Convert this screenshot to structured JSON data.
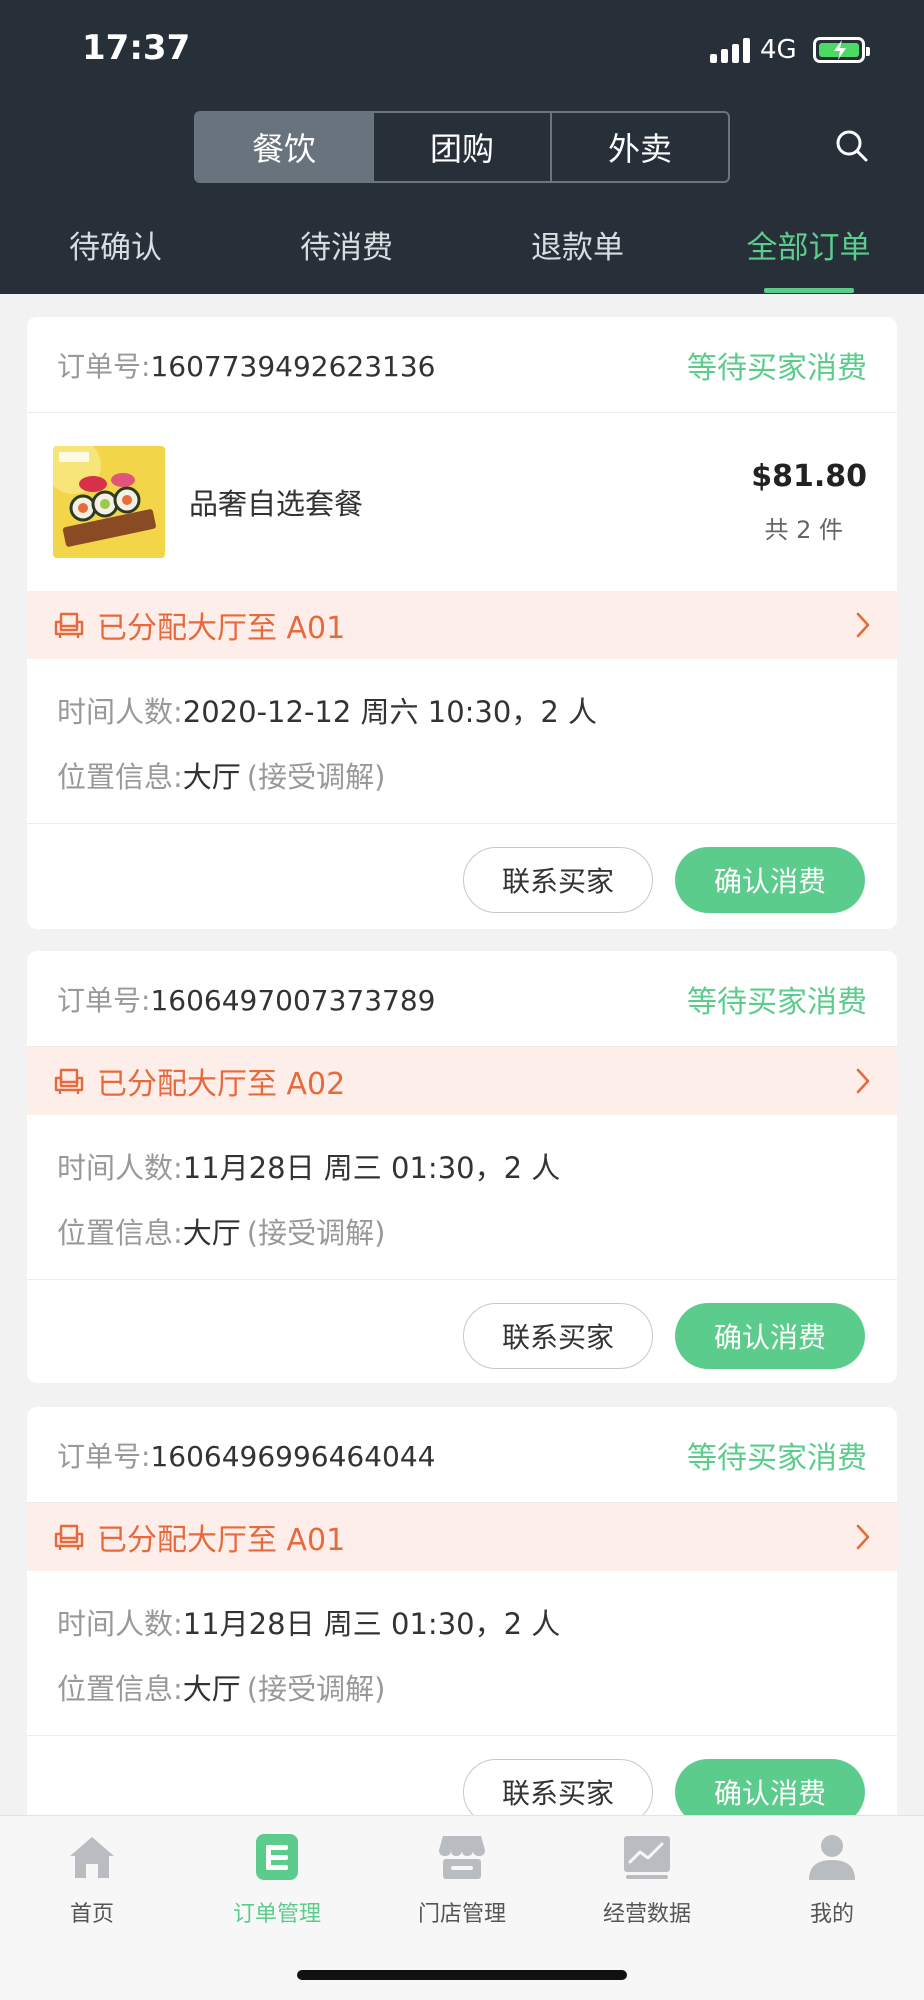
{
  "status_bar": {
    "time": "17:37",
    "network": "4G"
  },
  "segments": [
    {
      "label": "餐饮",
      "active": true
    },
    {
      "label": "团购",
      "active": false
    },
    {
      "label": "外卖",
      "active": false
    }
  ],
  "tabs": [
    {
      "label": "待确认"
    },
    {
      "label": "待消费"
    },
    {
      "label": "退款单"
    },
    {
      "label": "全部订单",
      "active": true
    }
  ],
  "orders": [
    {
      "order_label": "订单号:",
      "order_no": "1607739492623136",
      "status": "等待买家消费",
      "product": {
        "name": "品奢自选套餐",
        "price": "$81.80",
        "qty": "共 2 件"
      },
      "allocation": "已分配大厅至 A01",
      "time_label": "时间人数:",
      "time_value": "2020-12-12 周六 10:30，2 人",
      "loc_label": "位置信息:",
      "loc_value": "大厅",
      "loc_note": "(接受调解)",
      "btn_contact": "联系买家",
      "btn_confirm": "确认消费"
    },
    {
      "order_label": "订单号:",
      "order_no": "1606497007373789",
      "status": "等待买家消费",
      "allocation": "已分配大厅至 A02",
      "time_label": "时间人数:",
      "time_value": "11月28日 周三 01:30，2 人",
      "loc_label": "位置信息:",
      "loc_value": "大厅",
      "loc_note": "(接受调解)",
      "btn_contact": "联系买家",
      "btn_confirm": "确认消费"
    },
    {
      "order_label": "订单号:",
      "order_no": "1606496996464044",
      "status": "等待买家消费",
      "allocation": "已分配大厅至 A01",
      "time_label": "时间人数:",
      "time_value": "11月28日 周三 01:30，2 人",
      "loc_label": "位置信息:",
      "loc_value": "大厅",
      "loc_note": "(接受调解)",
      "btn_contact": "联系买家",
      "btn_confirm": "确认消费"
    }
  ],
  "tabbar": [
    {
      "label": "首页",
      "icon": "home-icon"
    },
    {
      "label": "订单管理",
      "icon": "order-management-icon",
      "active": true
    },
    {
      "label": "门店管理",
      "icon": "store-icon"
    },
    {
      "label": "经营数据",
      "icon": "chart-icon"
    },
    {
      "label": "我的",
      "icon": "profile-icon"
    }
  ],
  "colors": {
    "accent": "#5ccc8c",
    "header_bg": "#273039",
    "alloc_text": "#e8693c",
    "alloc_bg": "#fdeeea"
  }
}
